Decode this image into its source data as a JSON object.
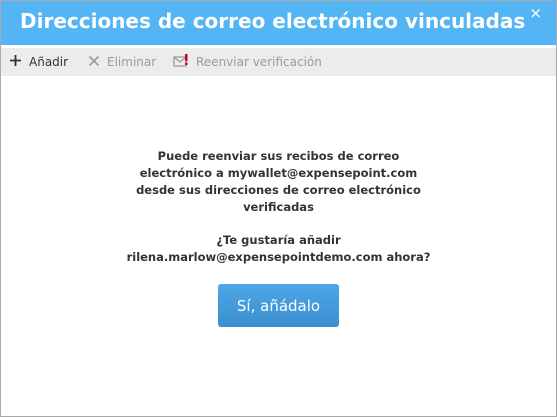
{
  "dialog": {
    "title": "Direcciones de correo electrónico vinculadas",
    "close_icon": "×"
  },
  "toolbar": {
    "add_label": "Añadir",
    "delete_label": "Eliminar",
    "resend_label": "Reenviar verificación"
  },
  "message": {
    "lines": [
      "Puede reenviar sus recibos de correo",
      "electrónico a mywallet@expensepoint.com",
      "desde sus direcciones de correo electrónico",
      "verificadas"
    ],
    "question_lines": [
      "¿Te gustaría añadir",
      "rilena.marlow@expensepointdemo.com ahora?"
    ]
  },
  "confirm_button_label": "Sí, añádalo",
  "colors": {
    "titlebar": "#54b5f4",
    "toolbar": "#ececec",
    "button": "#3a8fcf"
  },
  "icons": {
    "add": "plus-icon",
    "delete": "x-icon",
    "resend": "envelope-alert-icon",
    "close": "close-icon"
  }
}
